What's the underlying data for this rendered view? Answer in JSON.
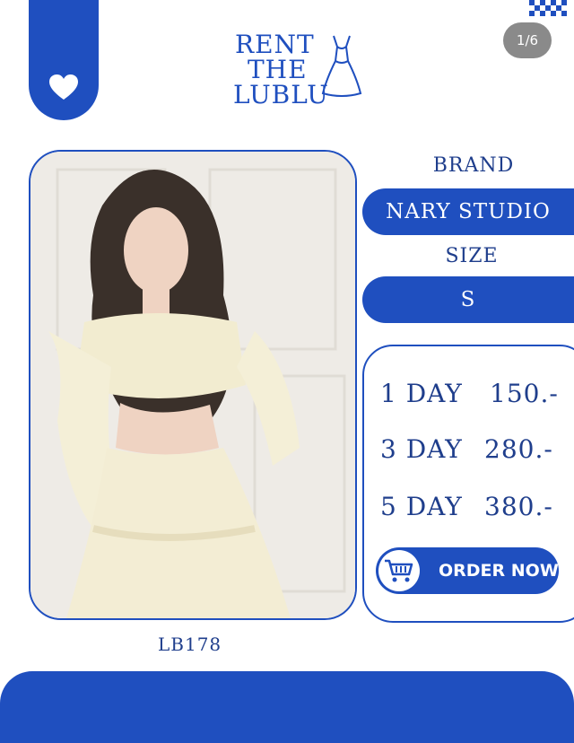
{
  "header": {
    "logo_line1": "RENT",
    "logo_line2": "THE",
    "logo_line3": "LUBLU",
    "image_counter": "1/6"
  },
  "product": {
    "code": "LB178",
    "brand_label": "BRAND",
    "brand_value": "NARY STUDIO",
    "size_label": "SIZE",
    "size_value": "S"
  },
  "pricing": [
    {
      "duration": "1 DAY",
      "price": "150.-"
    },
    {
      "duration": "3 DAY",
      "price": "280.-"
    },
    {
      "duration": "5 DAY",
      "price": "380.-"
    }
  ],
  "order_button_label": "ORDER NOW",
  "icons": {
    "favorite": "heart-icon",
    "cart": "cart-icon",
    "logo": "dress-icon"
  },
  "colors": {
    "accent": "#1f4fbf",
    "text_dark_blue": "#1f3e8c"
  }
}
